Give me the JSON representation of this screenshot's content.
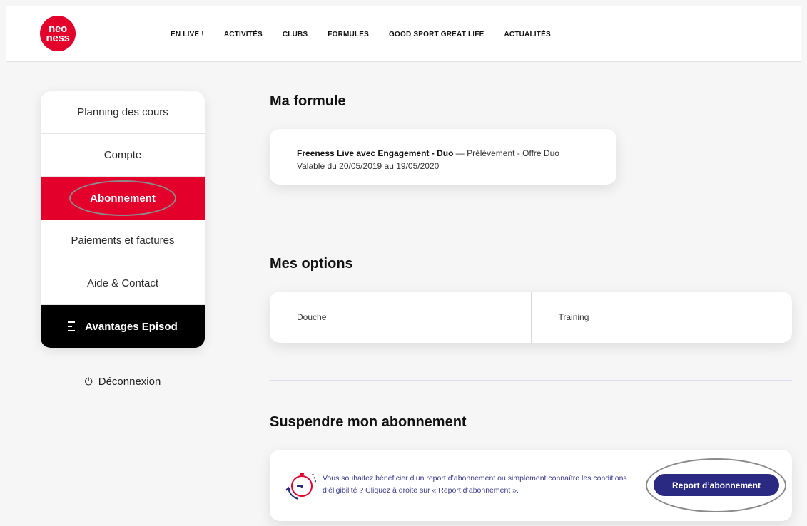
{
  "brand": {
    "logo_line1": "neo",
    "logo_line2": "ness",
    "color": "#e3002b"
  },
  "nav": {
    "items": [
      {
        "label": "EN LIVE !"
      },
      {
        "label": "ACTIVITÉS"
      },
      {
        "label": "CLUBS"
      },
      {
        "label": "FORMULES"
      },
      {
        "label": "GOOD SPORT GREAT LIFE"
      },
      {
        "label": "ACTUALITÉS"
      }
    ]
  },
  "sidebar": {
    "items": [
      {
        "label": "Planning des cours"
      },
      {
        "label": "Compte"
      },
      {
        "label": "Abonnement"
      },
      {
        "label": "Paiements et factures"
      },
      {
        "label": "Aide & Contact"
      },
      {
        "label": "Avantages Episod"
      }
    ],
    "logout": "Déconnexion"
  },
  "formule": {
    "title": "Ma formule",
    "name": "Freeness Live avec Engagement - Duo",
    "details": " — Prélèvement - Offre Duo",
    "validity": "Valable du 20/05/2019 au 19/05/2020"
  },
  "options": {
    "title": "Mes options",
    "items": [
      {
        "label": "Douche"
      },
      {
        "label": "Training"
      }
    ]
  },
  "suspend": {
    "title": "Suspendre mon abonnement",
    "text": "Vous souhaitez bénéficier d’un report d’abonnement ou simplement connaître les conditions d’éligibilité ? Cliquez à droite sur « Report d’abonnement ».",
    "button_label": "Report d’abonnement"
  },
  "colors": {
    "accent": "#e3002b",
    "button": "#2b2a82",
    "dark_item": "#000000"
  }
}
